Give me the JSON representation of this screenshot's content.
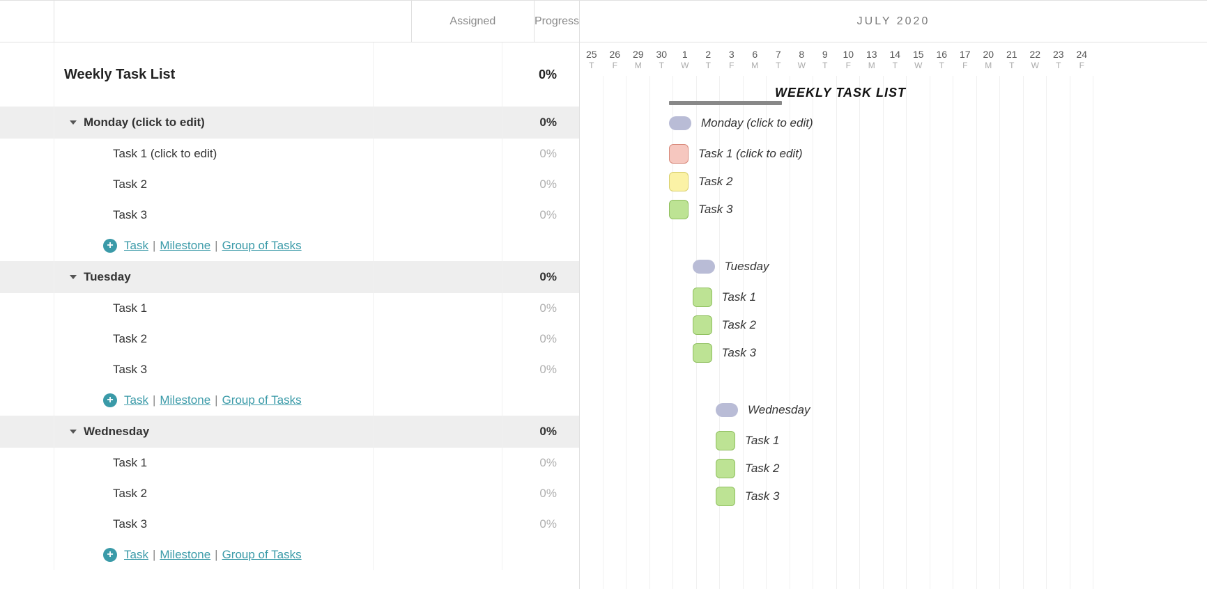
{
  "headers": {
    "assigned": "Assigned",
    "progress": "Progress"
  },
  "month_label": "JULY 2020",
  "dates": [
    {
      "d": "25",
      "w": "T"
    },
    {
      "d": "26",
      "w": "F"
    },
    {
      "d": "29",
      "w": "M"
    },
    {
      "d": "30",
      "w": "T"
    },
    {
      "d": "1",
      "w": "W"
    },
    {
      "d": "2",
      "w": "T"
    },
    {
      "d": "3",
      "w": "F"
    },
    {
      "d": "6",
      "w": "M"
    },
    {
      "d": "7",
      "w": "T"
    },
    {
      "d": "8",
      "w": "W"
    },
    {
      "d": "9",
      "w": "T"
    },
    {
      "d": "10",
      "w": "F"
    },
    {
      "d": "13",
      "w": "M"
    },
    {
      "d": "14",
      "w": "T"
    },
    {
      "d": "15",
      "w": "W"
    },
    {
      "d": "16",
      "w": "T"
    },
    {
      "d": "17",
      "w": "F"
    },
    {
      "d": "20",
      "w": "M"
    },
    {
      "d": "21",
      "w": "T"
    },
    {
      "d": "22",
      "w": "W"
    },
    {
      "d": "23",
      "w": "T"
    },
    {
      "d": "24",
      "w": "F"
    }
  ],
  "project": {
    "title": "Weekly Task List",
    "progress": "0%"
  },
  "timeline_title": "WEEKLY TASK LIST",
  "addlinks": {
    "task": "Task",
    "milestone": "Milestone",
    "group": "Group of Tasks"
  },
  "groups": [
    {
      "name": "Monday (click to edit)",
      "progress": "0%",
      "day_col": 4,
      "tasks": [
        {
          "name": "Task 1 (click to edit)",
          "progress": "0%",
          "color": "c-red",
          "day_col": 4
        },
        {
          "name": "Task 2",
          "progress": "0%",
          "color": "c-yellow",
          "day_col": 4
        },
        {
          "name": "Task 3",
          "progress": "0%",
          "color": "c-green",
          "day_col": 4
        }
      ]
    },
    {
      "name": "Tuesday",
      "progress": "0%",
      "day_col": 5,
      "tasks": [
        {
          "name": "Task 1",
          "progress": "0%",
          "color": "c-green",
          "day_col": 5
        },
        {
          "name": "Task 2",
          "progress": "0%",
          "color": "c-green",
          "day_col": 5
        },
        {
          "name": "Task 3",
          "progress": "0%",
          "color": "c-green",
          "day_col": 5
        }
      ]
    },
    {
      "name": "Wednesday",
      "progress": "0%",
      "day_col": 6,
      "tasks": [
        {
          "name": "Task 1",
          "progress": "0%",
          "color": "c-green",
          "day_col": 6
        },
        {
          "name": "Task 2",
          "progress": "0%",
          "color": "c-green",
          "day_col": 6
        },
        {
          "name": "Task 3",
          "progress": "0%",
          "color": "c-green",
          "day_col": 6
        }
      ]
    }
  ]
}
